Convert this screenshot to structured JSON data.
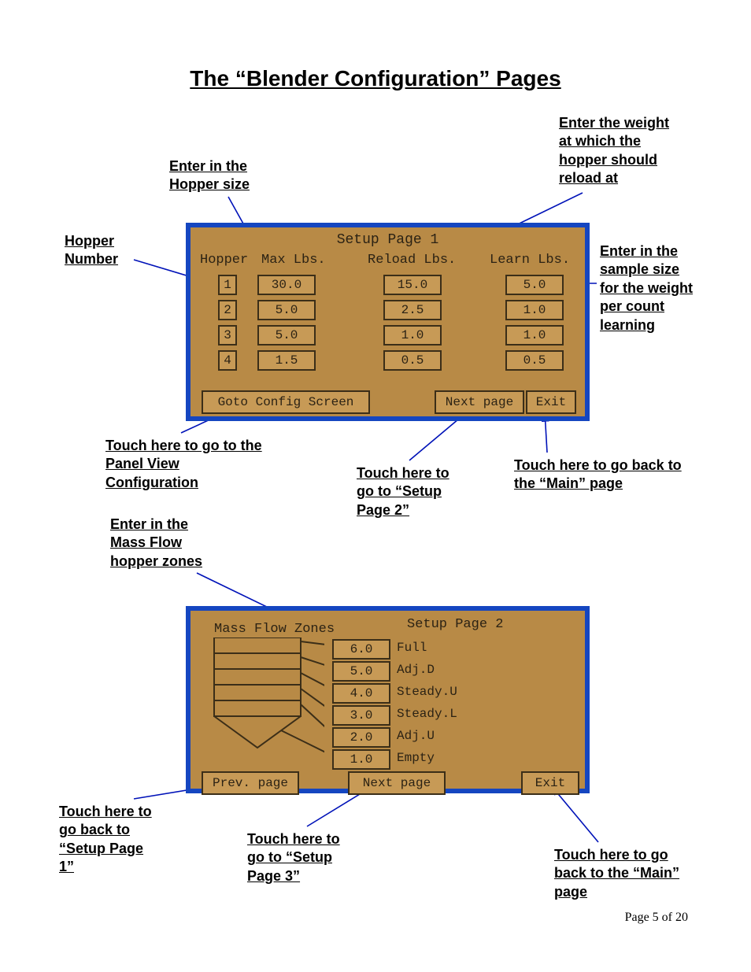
{
  "title": "The “Blender Configuration” Pages",
  "footer": "Page 5 of 20",
  "callouts": {
    "hopper_size": "Enter in the Hopper size",
    "reload_weight": "Enter the weight at which the hopper should reload at",
    "hopper_number": "Hopper Number",
    "sample_size": "Enter in the sample size for the weight per count learning",
    "panelview": "Touch here to go to the Panel View Configuration",
    "setup2": "Touch here to go to “Setup Page 2”",
    "main1": "Touch here to go back to the “Main” page",
    "massflow": "Enter in the Mass Flow hopper zones",
    "setup1_back": "Touch here to go back to “Setup Page 1”",
    "setup3": "Touch here to go to “Setup Page 3”",
    "main2": "Touch here to go back to the “Main” page"
  },
  "screen1": {
    "title": "Setup Page 1",
    "col_hopper": "Hopper",
    "col_max": "Max Lbs.",
    "col_reload": "Reload Lbs.",
    "col_learn": "Learn Lbs.",
    "rows": [
      {
        "n": "1",
        "max": "30.0",
        "reload": "15.0",
        "learn": "5.0"
      },
      {
        "n": "2",
        "max": "5.0",
        "reload": "2.5",
        "learn": "1.0"
      },
      {
        "n": "3",
        "max": "5.0",
        "reload": "1.0",
        "learn": "1.0"
      },
      {
        "n": "4",
        "max": "1.5",
        "reload": "0.5",
        "learn": "0.5"
      }
    ],
    "btn_config": "Goto Config Screen",
    "btn_next": "Next page",
    "btn_exit": "Exit"
  },
  "screen2": {
    "title": "Setup Page 2",
    "heading": "Mass Flow Zones",
    "zones": [
      {
        "v": "6.0",
        "lbl": "Full"
      },
      {
        "v": "5.0",
        "lbl": "Adj.D"
      },
      {
        "v": "4.0",
        "lbl": "Steady.U"
      },
      {
        "v": "3.0",
        "lbl": "Steady.L"
      },
      {
        "v": "2.0",
        "lbl": "Adj.U"
      },
      {
        "v": "1.0",
        "lbl": "Empty"
      }
    ],
    "btn_prev": "Prev. page",
    "btn_next": "Next page",
    "btn_exit": "Exit"
  }
}
